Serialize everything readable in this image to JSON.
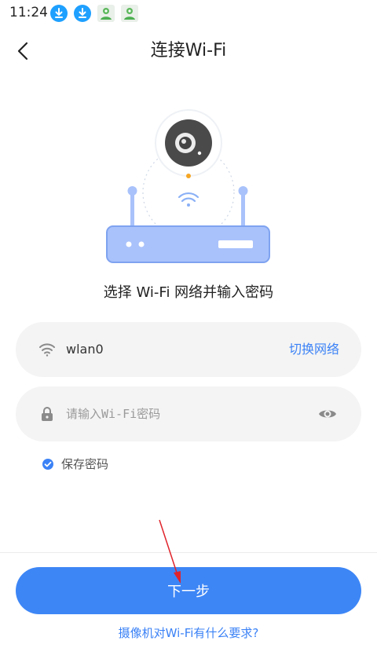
{
  "status_bar": {
    "time": "11:24",
    "icons": [
      "download-icon",
      "download-icon",
      "app-notification-icon",
      "app-notification-icon"
    ]
  },
  "header": {
    "title": "连接Wi-Fi",
    "back_icon": "chevron-left-icon"
  },
  "illustration": {
    "icons": [
      "camera-icon",
      "wifi-icon",
      "router-icon"
    ]
  },
  "instruction": "选择 Wi-Fi 网络并输入密码",
  "wifi_field": {
    "icon": "wifi-icon",
    "ssid": "wlan0",
    "switch_label": "切换网络"
  },
  "password_field": {
    "icon": "lock-icon",
    "placeholder": "请输入Wi-Fi密码",
    "value": "",
    "visibility_icon": "eye-icon"
  },
  "remember": {
    "checked": true,
    "label": "保存密码"
  },
  "actions": {
    "next_label": "下一步",
    "help_link": "摄像机对Wi-Fi有什么要求?"
  },
  "colors": {
    "accent": "#3d86f6",
    "link": "#3b82f6",
    "field_bg": "#f4f4f4",
    "router": "#a9c2fb",
    "annotation": "#e0242b"
  }
}
